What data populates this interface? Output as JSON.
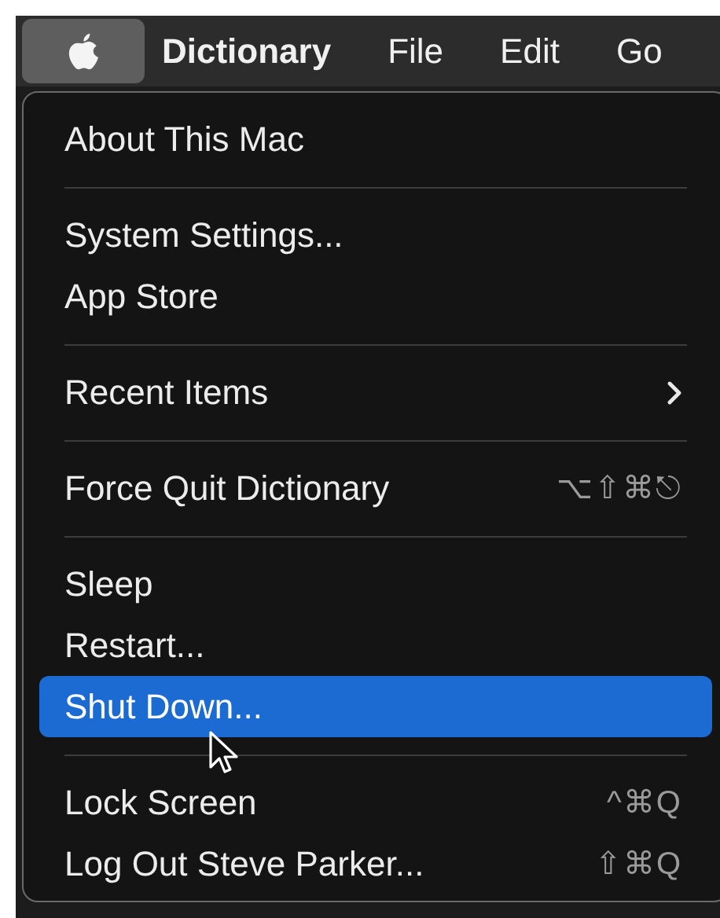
{
  "menu_bar": {
    "items": [
      {
        "label": "Dictionary",
        "selected": false,
        "bold": true
      },
      {
        "label": "File",
        "selected": false,
        "bold": false
      },
      {
        "label": "Edit",
        "selected": false,
        "bold": false
      },
      {
        "label": "Go",
        "selected": false,
        "bold": false
      }
    ],
    "apple_menu_selected": true
  },
  "menu": {
    "sections": [
      [
        {
          "label": "About This Mac",
          "selected": false
        }
      ],
      [
        {
          "label": "System Settings...",
          "selected": false
        },
        {
          "label": "App Store",
          "selected": false
        }
      ],
      [
        {
          "label": "Recent Items",
          "selected": false,
          "submenu": true
        }
      ],
      [
        {
          "label": "Force Quit Dictionary",
          "selected": false,
          "shortcut": "⌥⇧⌘⎋"
        }
      ],
      [
        {
          "label": "Sleep",
          "selected": false
        },
        {
          "label": "Restart...",
          "selected": false
        },
        {
          "label": "Shut Down...",
          "selected": true
        }
      ],
      [
        {
          "label": "Lock Screen",
          "selected": false,
          "shortcut": "^⌘Q"
        },
        {
          "label": "Log Out Steve Parker...",
          "selected": false,
          "shortcut": "⇧⌘Q"
        }
      ]
    ]
  }
}
